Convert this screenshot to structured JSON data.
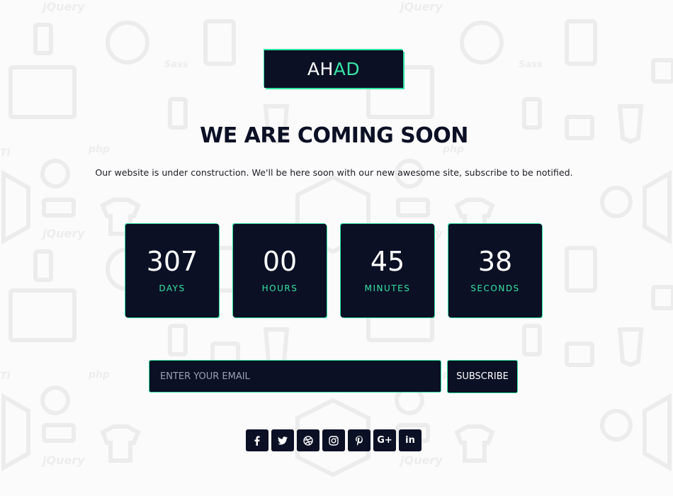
{
  "logo": {
    "part1": "AH",
    "part2": "AD"
  },
  "title": "WE ARE COMING SOON",
  "subtitle": "Our website is under construction. We'll be here soon with our new awesome site, subscribe to be notified.",
  "countdown": [
    {
      "value": "307",
      "label": "DAYS"
    },
    {
      "value": "00",
      "label": "HOURS"
    },
    {
      "value": "45",
      "label": "MINUTES"
    },
    {
      "value": "38",
      "label": "SECONDS"
    }
  ],
  "form": {
    "email_placeholder": "ENTER YOUR EMAIL",
    "email_value": "",
    "subscribe_label": "SUBSCRIBE"
  },
  "social": {
    "icons": [
      "facebook-icon",
      "twitter-icon",
      "dribbble-icon",
      "instagram-icon",
      "pinterest-icon",
      "google-plus-icon",
      "linkedin-icon"
    ],
    "gplus_text": "G+",
    "linkedin_text": "in"
  },
  "colors": {
    "dark": "#0b1025",
    "accent": "#38e3a4",
    "text": "#ffffff",
    "background": "#fbfbfb"
  }
}
